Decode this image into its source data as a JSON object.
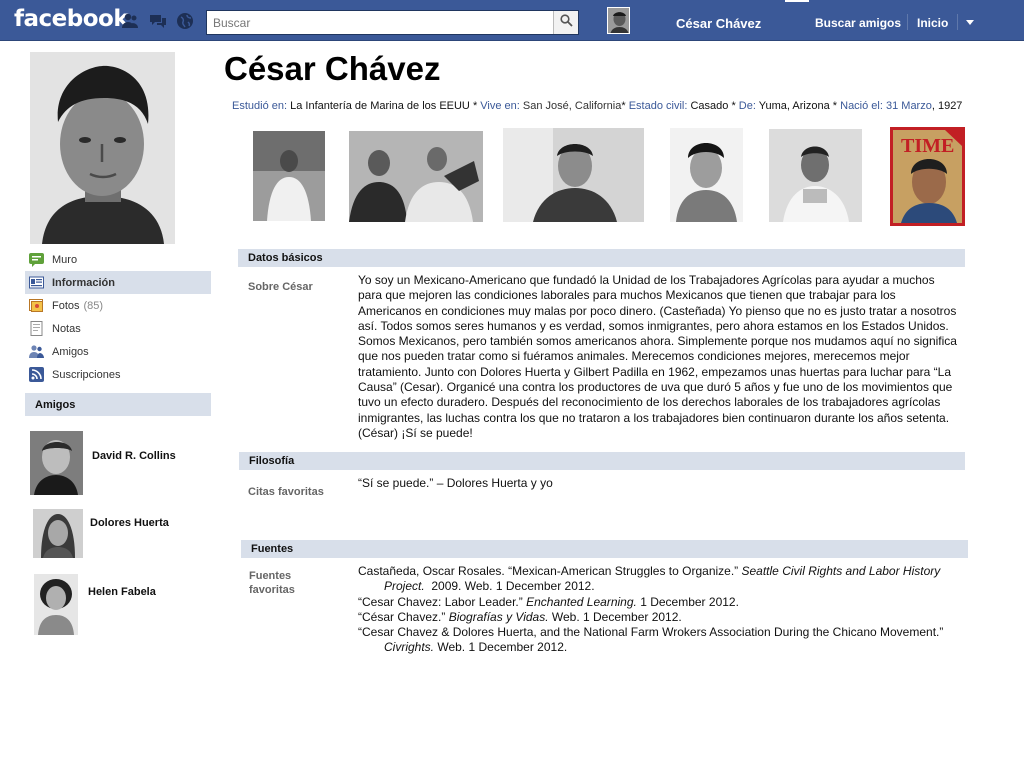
{
  "topbar": {
    "logo": "facebook",
    "search_placeholder": "Buscar",
    "user_name": "César Chávez",
    "find_friends": "Buscar amigos",
    "home": "Inicio",
    "icons": [
      "friend-requests-icon",
      "messages-icon",
      "notifications-globe-icon",
      "magnifier-icon",
      "dropdown-caret-icon"
    ],
    "bar_color": "#3b5998"
  },
  "profile": {
    "name": "César Chávez",
    "info": [
      {
        "label": "Estudió en:",
        "value": "La Infantería de Marina de los EEUU",
        "sep": "*"
      },
      {
        "label": "Vive en:",
        "value": "San José, California",
        "sep": "*"
      },
      {
        "label": "Estado civil:",
        "value": "Casado",
        "sep": "*"
      },
      {
        "label": "De:",
        "value": "Yuma, Arizona",
        "sep": "*"
      },
      {
        "label": "Nació el:",
        "value": "31 Marzo",
        "suffix": ", 1927"
      }
    ]
  },
  "nav": {
    "items": [
      {
        "label": "Muro",
        "icon": "wall-icon"
      },
      {
        "label": "Información",
        "icon": "info-icon"
      },
      {
        "label": "Fotos",
        "count": "(85)",
        "icon": "photos-icon"
      },
      {
        "label": "Notas",
        "icon": "notes-icon"
      },
      {
        "label": "Amigos",
        "icon": "friends-icon"
      },
      {
        "label": "Suscripciones",
        "icon": "subscriptions-icon"
      }
    ]
  },
  "friends": {
    "heading": "Amigos",
    "list": [
      {
        "name": "David R. Collins"
      },
      {
        "name": "Dolores Huerta"
      },
      {
        "name": "Helen Fabela"
      }
    ]
  },
  "photos": {
    "time_label": "TIME"
  },
  "sections": {
    "basic": {
      "heading": "Datos básicos",
      "label": "Sobre César",
      "text": "Yo soy un Mexicano-Americano que fundadó la Unidad de los Trabajadores Agrícolas para ayudar a muchos para que mejoren las condiciones laborales para muchos Mexicanos que tienen que trabajar para los Americanos en condiciones muy malas por poco dinero. (Casteñada) Yo pienso que no es justo tratar a nosotros así. Todos somos seres humanos y es verdad, somos inmigrantes, pero ahora estamos en los Estados Unidos. Somos Mexicanos, pero también somos americanos ahora. Simplemente porque nos mudamos aquí no significa que nos pueden tratar como si fuéramos animales. Merecemos condiciones mejores, merecemos mejor tratamiento. Junto con Dolores Huerta y Gilbert Padilla en 1962, empezamos unas huertas para luchar para “La Causa” (Cesar). Organicé una contra los productores de uva que duró 5 años y fue uno de los movimientos que tuvo un efecto duradero. Después del reconocimiento de los derechos laborales de los trabajadores agrícolas inmigrantes, las luchas contra los que no trataron a los trabajadores bien continuaron durante los años setenta. (César) ¡Sí se puede!"
    },
    "philosophy": {
      "heading": "Filosofía",
      "label": "Citas favoritas",
      "text": "“Sí se puede.” – Dolores Huerta y yo"
    },
    "sources": {
      "heading": "Fuentes",
      "label": "Fuentes favoritas",
      "entries": [
        {
          "pre": "Castañeda, Oscar Rosales. “Mexican-American Struggles to Organize.” ",
          "ital": "Seattle Civil Rights and Labor History Project.",
          "post": "  2009. Web. 1 December 2012."
        },
        {
          "pre": "“Cesar Chavez: Labor Leader.” ",
          "ital": "Enchanted Learning.",
          "post": " 1 December 2012."
        },
        {
          "pre": "“César Chavez.” ",
          "ital": "Biografías y Vidas.",
          "post": " Web. 1 December 2012."
        },
        {
          "pre": "“Cesar Chavez & Dolores Huerta, and the National Farm Wrokers Association During the Chicano Movement.” ",
          "ital": "Civrights.",
          "post": " Web. 1 December 2012."
        }
      ]
    }
  }
}
